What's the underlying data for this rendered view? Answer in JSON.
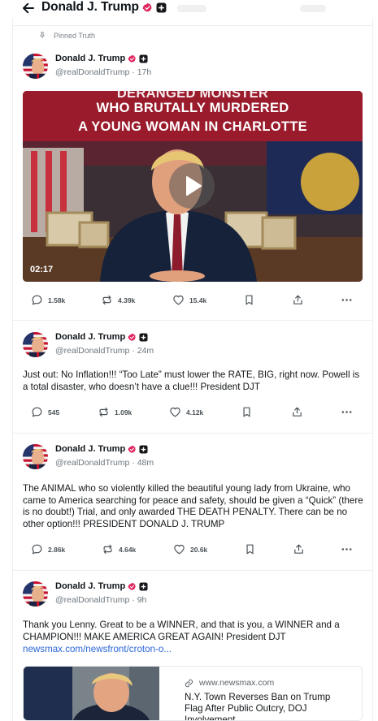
{
  "header": {
    "title": "Donald J. Trump"
  },
  "pinned_label": "Pinned Truth",
  "posts": [
    {
      "name": "Donald J. Trump",
      "handle_time": "@realDonaldTrump · 17h",
      "video": {
        "caption_line1": "DERANGED MONSTER",
        "caption_line2": "WHO BRUTALLY MURDERED",
        "caption_line3": "A YOUNG WOMAN IN CHARLOTTE",
        "duration": "02:17"
      },
      "replies": "1.58k",
      "retruths": "4.39k",
      "likes": "15.4k"
    },
    {
      "name": "Donald J. Trump",
      "handle_time": "@realDonaldTrump · 24m",
      "text": "Just out: No Inflation!!! “Too Late” must lower the RATE, BIG, right now. Powell is a total disaster, who doesn’t have a clue!!! President DJT",
      "replies": "545",
      "retruths": "1.09k",
      "likes": "4.12k"
    },
    {
      "name": "Donald J. Trump",
      "handle_time": "@realDonaldTrump · 48m",
      "text": "The ANIMAL who so violently killed the beautiful young lady from Ukraine, who came to America searching for peace and safety, should be given a “Quick” (there is no doubt!) Trial, and only awarded THE DEATH PENALTY. There can be no other option!!! PRESIDENT DONALD J. TRUMP",
      "replies": "2.86k",
      "retruths": "4.64k",
      "likes": "20.6k"
    },
    {
      "name": "Donald J. Trump",
      "handle_time": "@realDonaldTrump · 9h",
      "text": "Thank you Lenny. Great to be a WINNER, and that is you, a WINNER and a CHAMPION!!! MAKE AMERICA GREAT AGAIN! President DJT",
      "link": "newsmax.com/newsfront/croton-o...",
      "card": {
        "domain": "www.newsmax.com",
        "title": "N.Y. Town Reverses Ban on Trump Flag After Public Outcry, DOJ Involvement"
      }
    }
  ],
  "colors": {
    "verified_badge": "#e0245e",
    "link": "#2a66d9",
    "banner_red": "#9a1b2c"
  }
}
